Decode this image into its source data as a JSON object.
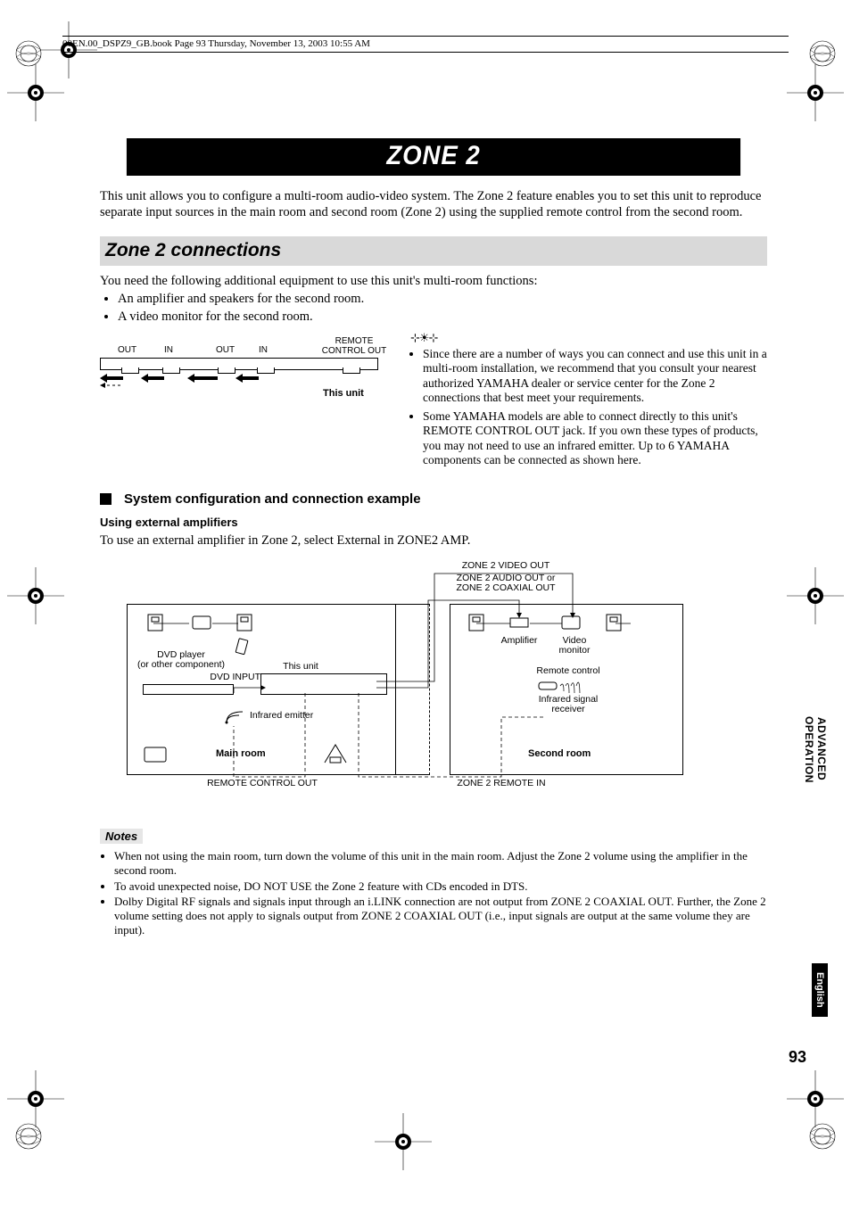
{
  "header_text": "00EN.00_DSPZ9_GB.book  Page 93  Thursday, November 13, 2003  10:55 AM",
  "title": "ZONE 2",
  "intro": "This unit allows you to configure a multi-room audio-video system. The Zone 2 feature enables you to set this unit to reproduce separate input sources in the main room and second room (Zone 2) using the supplied remote control from the second room.",
  "section_title": "Zone 2 connections",
  "need_text": "You need the following additional equipment to use this unit's multi-room functions:",
  "need_items": [
    "An amplifier and speakers for the second room.",
    "A video monitor for the second room."
  ],
  "diag1": {
    "labels": {
      "out1": "OUT",
      "in1": "IN",
      "out2": "OUT",
      "in2": "IN",
      "remote": "REMOTE\nCONTROL OUT"
    },
    "caption": "This unit"
  },
  "tips": [
    "Since there are a number of ways you can connect and use this unit in a multi-room installation, we recommend that you consult your nearest authorized YAMAHA dealer or service center for the Zone 2 connections that best meet your requirements.",
    "Some YAMAHA models are able to connect directly to this unit's REMOTE CONTROL OUT jack. If you own these types of products, you may not need to use an infrared emitter. Up to 6 YAMAHA components can be connected as shown here."
  ],
  "sub_head": "System configuration and connection example",
  "sub_sub": "Using external amplifiers",
  "sub_body": "To use an external amplifier in Zone 2, select External in ZONE2 AMP.",
  "chart_data": {
    "type": "diagram",
    "top_labels": {
      "video_out": "ZONE 2 VIDEO OUT",
      "audio_out": "ZONE 2 AUDIO OUT or\nZONE 2 COAXIAL OUT"
    },
    "main_room": {
      "label": "Main room",
      "dvd_label": "DVD player\n(or other component)",
      "dvd_input": "DVD INPUT",
      "this_unit": "This unit",
      "ir_emitter": "Infrared emitter",
      "remote_out": "REMOTE CONTROL OUT"
    },
    "second_room": {
      "label": "Second room",
      "amplifier": "Amplifier",
      "video_monitor": "Video\nmonitor",
      "remote_ctrl": "Remote control",
      "ir_receiver": "Infrared signal\nreceiver",
      "remote_in": "ZONE 2 REMOTE IN"
    }
  },
  "notes_head": "Notes",
  "notes": [
    "When not using the main room, turn down the volume of this unit in the main room. Adjust the Zone 2 volume using the amplifier in the second room.",
    "To avoid unexpected noise, DO NOT USE the Zone 2 feature with CDs encoded in DTS.",
    "Dolby Digital RF signals and signals input through an i.LINK connection are not output from ZONE 2 COAXIAL OUT. Further, the Zone 2 volume setting does not apply to signals output from ZONE 2 COAXIAL OUT (i.e., input signals are output at the same volume they are input)."
  ],
  "side_tab_adv": "ADVANCED\nOPERATION",
  "side_tab_eng": "English",
  "page_number": "93"
}
